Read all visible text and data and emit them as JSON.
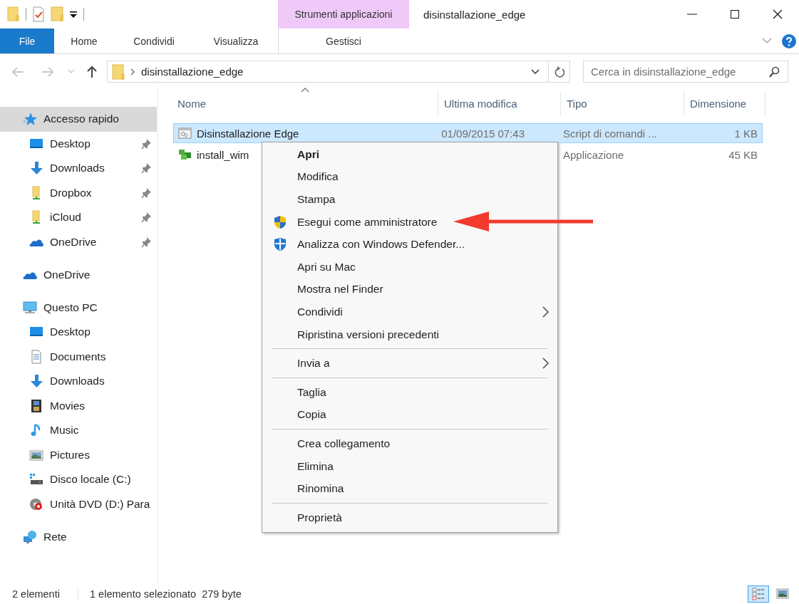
{
  "window": {
    "title": "disinstallazione_edge",
    "contextual_group": "Strumenti applicazioni"
  },
  "quick_access_toolbar": [
    {
      "kind": "folder"
    },
    {
      "kind": "properties"
    },
    {
      "kind": "new-folder"
    },
    {
      "kind": "customize"
    }
  ],
  "ribbon": {
    "tabs": [
      {
        "label": "File",
        "kind": "file"
      },
      {
        "label": "Home",
        "kind": "tab"
      },
      {
        "label": "Condividi",
        "kind": "tab"
      },
      {
        "label": "Visualizza",
        "kind": "tab"
      },
      {
        "label": "Gestisci",
        "kind": "contextual"
      }
    ]
  },
  "navigation": [
    {
      "kind": "back",
      "disabled": true
    },
    {
      "kind": "forward",
      "disabled": true
    },
    {
      "kind": "recent",
      "disabled": true
    },
    {
      "kind": "up",
      "disabled": false
    }
  ],
  "address_bar": {
    "path": "disinstallazione_edge"
  },
  "search": {
    "placeholder": "Cerca in disinstallazione_edge"
  },
  "sidebar": {
    "items": [
      {
        "label": "Accesso rapido",
        "kind": "quick-access",
        "selected": true,
        "children": [
          {
            "label": "Desktop",
            "kind": "desktop",
            "selected": false,
            "pinned": true
          },
          {
            "label": "Downloads",
            "kind": "downloads",
            "selected": false,
            "pinned": true
          },
          {
            "label": "Dropbox",
            "kind": "synced-folder",
            "selected": false,
            "pinned": true
          },
          {
            "label": "iCloud",
            "kind": "synced-folder",
            "selected": false,
            "pinned": true
          },
          {
            "label": "OneDrive",
            "kind": "cloud",
            "selected": false,
            "pinned": true
          }
        ]
      },
      {
        "label": "OneDrive",
        "kind": "cloud",
        "selected": false
      },
      {
        "label": "Questo PC",
        "kind": "pc",
        "selected": false,
        "children": [
          {
            "label": "Desktop",
            "kind": "desktop",
            "selected": false
          },
          {
            "label": "Documents",
            "kind": "documents",
            "selected": false
          },
          {
            "label": "Downloads",
            "kind": "downloads",
            "selected": false
          },
          {
            "label": "Movies",
            "kind": "movies",
            "selected": false
          },
          {
            "label": "Music",
            "kind": "music",
            "selected": false
          },
          {
            "label": "Pictures",
            "kind": "pictures",
            "selected": false
          },
          {
            "label": "Disco locale (C:)",
            "kind": "disk",
            "selected": false
          },
          {
            "label": "Unità DVD (D:) Para",
            "kind": "dvd",
            "selected": false
          }
        ]
      },
      {
        "label": "Rete",
        "kind": "network",
        "selected": false
      }
    ]
  },
  "file_list": {
    "columns": [
      {
        "label": "Nome",
        "sorted": true
      },
      {
        "label": "Ultima modifica",
        "sorted": false
      },
      {
        "label": "Tipo",
        "sorted": false
      },
      {
        "label": "Dimensione",
        "sorted": false
      }
    ],
    "rows": [
      {
        "name": "Disinstallazione Edge",
        "kind": "script",
        "modified": "01/09/2015 07:43",
        "type": "Script di comandi ...",
        "size": "1 KB",
        "selected": true
      },
      {
        "name": "install_wim",
        "kind": "application",
        "type": "Applicazione",
        "size": "45 KB",
        "selected": false
      }
    ]
  },
  "context_menu": {
    "items": [
      {
        "kind": "item",
        "label": "Apri",
        "default": true
      },
      {
        "kind": "item",
        "label": "Modifica"
      },
      {
        "kind": "item",
        "label": "Stampa"
      },
      {
        "kind": "shield",
        "label": "Esegui come amministratore"
      },
      {
        "kind": "scan",
        "label": "Analizza con Windows Defender..."
      },
      {
        "kind": "item",
        "label": "Apri su Mac"
      },
      {
        "kind": "item",
        "label": "Mostra nel Finder"
      },
      {
        "kind": "item",
        "label": "Condividi",
        "submenu": true
      },
      {
        "kind": "item",
        "label": "Ripristina versioni precedenti"
      },
      {
        "kind": "separator"
      },
      {
        "kind": "item",
        "label": "Invia a",
        "submenu": true
      },
      {
        "kind": "separator"
      },
      {
        "kind": "item",
        "label": "Taglia"
      },
      {
        "kind": "item",
        "label": "Copia"
      },
      {
        "kind": "separator"
      },
      {
        "kind": "item",
        "label": "Crea collegamento"
      },
      {
        "kind": "item",
        "label": "Elimina"
      },
      {
        "kind": "item",
        "label": "Rinomina"
      },
      {
        "kind": "separator"
      },
      {
        "kind": "item",
        "label": "Proprietà"
      }
    ]
  },
  "status_bar": {
    "item_count": "2 elementi",
    "selection": "1 elemento selezionato",
    "selection_size": "279 byte",
    "views": [
      {
        "kind": "details",
        "selected": true
      },
      {
        "kind": "large-icons",
        "selected": false
      }
    ]
  }
}
